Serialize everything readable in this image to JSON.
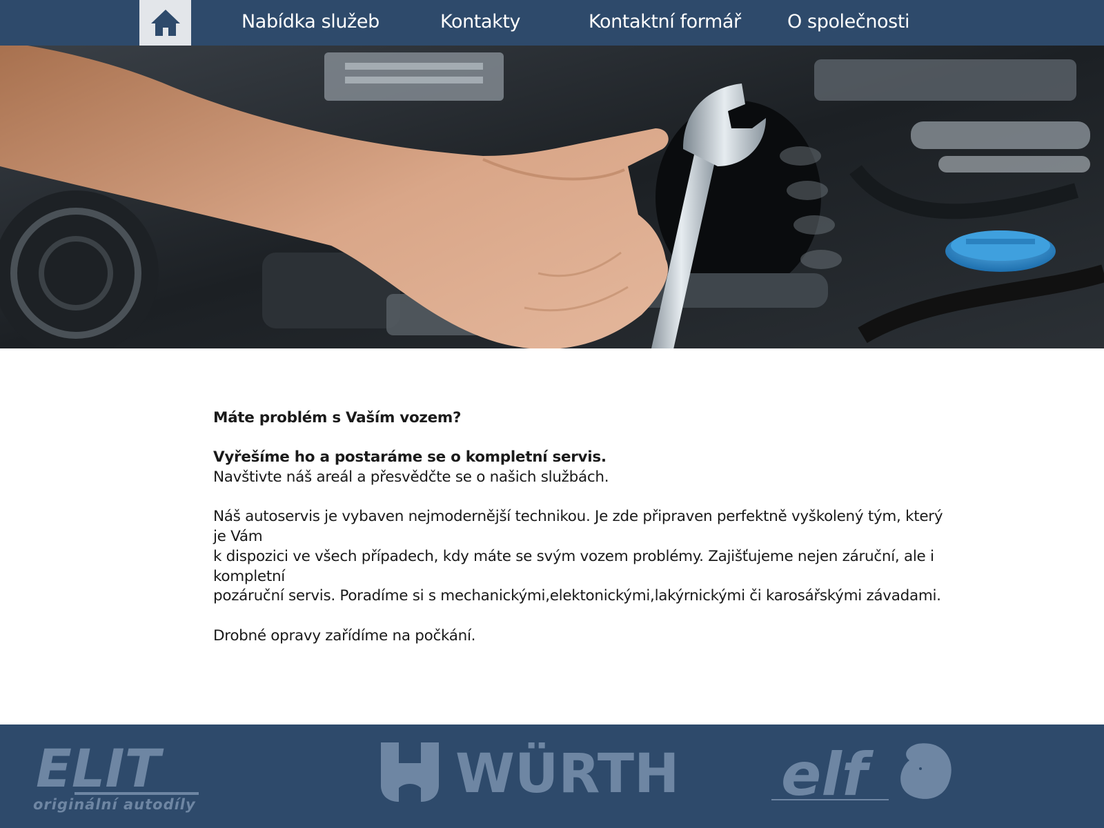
{
  "nav": {
    "home_icon": "home-icon",
    "items": [
      {
        "label": "Nabídka služeb"
      },
      {
        "label": "Kontakty"
      },
      {
        "label": "Kontaktní formář"
      },
      {
        "label": "O společnosti"
      }
    ]
  },
  "content": {
    "heading": "Máte problém s Vaším vozem?",
    "subheading": "Vyřešíme ho a postaráme se o kompletní servis.",
    "line1": "Navštivte náš areál a přesvědčte se o našich službách.",
    "para_line1": "Náš autoservis je vybaven nejmodernější technikou. Je zde připraven perfektně vyškolený tým, který je Vám",
    "para_line2": "k dispozici ve všech případech, kdy máte se svým vozem problémy. Zajišťujeme nejen záruční, ale i kompletní",
    "para_line3": "pozáruční servis. Poradíme si s mechanickými,elektonickými,lakýrnickými či karosářskými závadami.",
    "closing": "Drobné opravy zařídíme na počkání."
  },
  "footer": {
    "logos": [
      {
        "name": "ELIT",
        "tagline": "originální autodíly"
      },
      {
        "name": "WÜRTH"
      },
      {
        "name": "elf"
      }
    ]
  },
  "colors": {
    "nav_bg": "#2e4a6b",
    "home_bg": "#e3e6ea",
    "footer_logo": "#6e86a3"
  }
}
